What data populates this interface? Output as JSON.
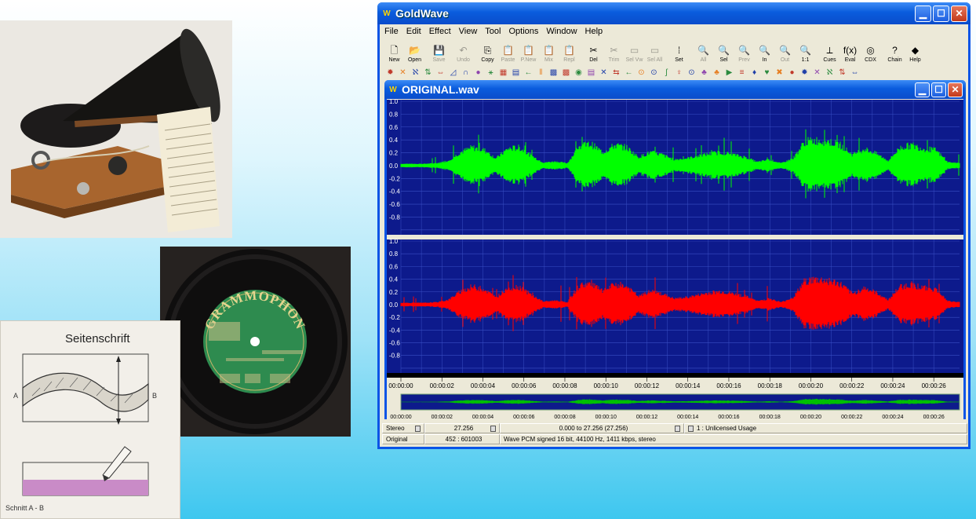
{
  "gw": {
    "title": "GoldWave",
    "menu": [
      "File",
      "Edit",
      "Effect",
      "View",
      "Tool",
      "Options",
      "Window",
      "Help"
    ],
    "toolbar": [
      {
        "label": "New",
        "icon": "new-icon",
        "glyph": "🗋",
        "enabled": true
      },
      {
        "label": "Open",
        "icon": "open-icon",
        "glyph": "📂",
        "enabled": true
      },
      {
        "label": "Save",
        "icon": "save-icon",
        "glyph": "💾",
        "enabled": false
      },
      {
        "label": "Undo",
        "icon": "undo-icon",
        "glyph": "↶",
        "enabled": false
      },
      {
        "label": "Copy",
        "icon": "copy-icon",
        "glyph": "⎘",
        "enabled": true
      },
      {
        "label": "Paste",
        "icon": "paste-icon",
        "glyph": "📋",
        "enabled": false
      },
      {
        "label": "P.New",
        "icon": "paste-new-icon",
        "glyph": "📋",
        "enabled": false
      },
      {
        "label": "Mix",
        "icon": "mix-icon",
        "glyph": "📋",
        "enabled": false
      },
      {
        "label": "Repl",
        "icon": "replace-icon",
        "glyph": "📋",
        "enabled": false
      },
      {
        "label": "Del",
        "icon": "delete-icon",
        "glyph": "✂",
        "enabled": true
      },
      {
        "label": "Trim",
        "icon": "trim-icon",
        "glyph": "✂",
        "enabled": false
      },
      {
        "label": "Sel Vw",
        "icon": "select-view-icon",
        "glyph": "▭",
        "enabled": false
      },
      {
        "label": "Sel All",
        "icon": "select-all-icon",
        "glyph": "▭",
        "enabled": false
      },
      {
        "label": "Set",
        "icon": "set-icon",
        "glyph": "⁞",
        "enabled": true
      },
      {
        "label": "All",
        "icon": "zoom-all-icon",
        "glyph": "🔍",
        "enabled": false
      },
      {
        "label": "Sel",
        "icon": "zoom-selection-icon",
        "glyph": "🔍",
        "enabled": true
      },
      {
        "label": "Prev",
        "icon": "zoom-previous-icon",
        "glyph": "🔍",
        "enabled": false
      },
      {
        "label": "In",
        "icon": "zoom-in-icon",
        "glyph": "🔍",
        "enabled": true
      },
      {
        "label": "Out",
        "icon": "zoom-out-icon",
        "glyph": "🔍",
        "enabled": false
      },
      {
        "label": "1:1",
        "icon": "zoom-1-1-icon",
        "glyph": "🔍",
        "enabled": true
      },
      {
        "label": "Cues",
        "icon": "cues-icon",
        "glyph": "⟂",
        "enabled": true
      },
      {
        "label": "Eval",
        "icon": "eval-icon",
        "glyph": "f(x)",
        "enabled": true
      },
      {
        "label": "CDX",
        "icon": "cd-extract-icon",
        "glyph": "◎",
        "enabled": true
      },
      {
        "label": "Chain",
        "icon": "chain-icon",
        "glyph": "?",
        "enabled": true
      },
      {
        "label": "Help",
        "icon": "help-book-icon",
        "glyph": "◆",
        "enabled": true
      }
    ],
    "effects_colors": [
      "#c0392b",
      "#e67e22",
      "#1f3fa8",
      "#2b8a3e",
      "#c0392b",
      "#1f3fa8",
      "#1f3fa8",
      "#8e44ad",
      "#2b8a3e",
      "#c0392b",
      "#1f3fa8",
      "#2b8a3e",
      "#e67e22",
      "#1f3fa8",
      "#c0392b",
      "#2b8a3e",
      "#8e44ad",
      "#1f3fa8",
      "#c0392b",
      "#2b8a3e",
      "#e67e22",
      "#1f3fa8",
      "#2b8a3e",
      "#c0392b",
      "#1f3fa8",
      "#8e44ad",
      "#e67e22",
      "#2b8a3e",
      "#c0392b",
      "#1f3fa8",
      "#2b8a3e",
      "#e67e22",
      "#c0392b",
      "#1f3fa8",
      "#8e44ad",
      "#2b8a3e",
      "#c0392b",
      "#1f3fa8"
    ],
    "child": {
      "title": "ORIGINAL.wav",
      "y_ticks": [
        "1.0",
        "0.8",
        "0.6",
        "0.4",
        "0.2",
        "0.0",
        "-0.2",
        "-0.4",
        "-0.6",
        "-0.8"
      ],
      "time_ticks": [
        "00:00:00",
        "00:00:02",
        "00:00:04",
        "00:00:06",
        "00:00:08",
        "00:00:10",
        "00:00:12",
        "00:00:14",
        "00:00:16",
        "00:00:18",
        "00:00:20",
        "00:00:22",
        "00:00:24",
        "00:00:26"
      ],
      "colors": {
        "background": "#0d1a8c",
        "grid": "#3a4fc4",
        "left_channel": "#00ff00",
        "right_channel": "#ff0000"
      },
      "envelope": [
        0.03,
        0.03,
        0.03,
        0.04,
        0.08,
        0.22,
        0.3,
        0.26,
        0.12,
        0.28,
        0.3,
        0.16,
        0.05,
        0.07,
        0.04,
        0.32,
        0.36,
        0.22,
        0.34,
        0.3,
        0.14,
        0.22,
        0.18,
        0.1,
        0.12,
        0.16,
        0.2,
        0.22,
        0.18,
        0.14,
        0.06,
        0.1,
        0.04,
        0.12,
        0.4,
        0.42,
        0.4,
        0.34,
        0.18,
        0.28,
        0.2,
        0.08,
        0.3,
        0.34,
        0.28,
        0.26,
        0.06,
        0.04
      ]
    },
    "status": {
      "channels": "Stereo",
      "length": "27.256",
      "selection": "0.000 to 27.256 (27.256)",
      "license": "1 : Unlicensed Usage",
      "mode": "Original",
      "position": "452 : 601003",
      "format": "Wave PCM signed 16 bit, 44100 Hz, 1411 kbps, stereo"
    }
  },
  "diagram": {
    "title": "Seitenschrift",
    "label_a": "A",
    "label_b": "B",
    "caption": "Schnitt A - B"
  },
  "record": {
    "brand": "GRAMMOPHON",
    "label_color": "#2e8b4f"
  }
}
